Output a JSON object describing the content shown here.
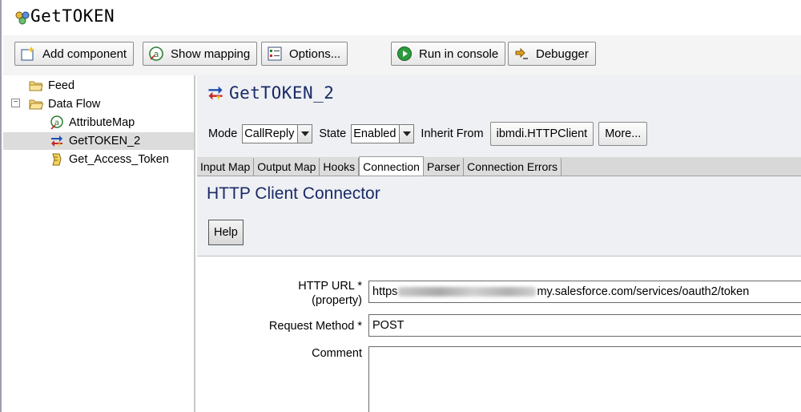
{
  "window": {
    "title": "GetTOKEN"
  },
  "toolbar": {
    "add_component": "Add component",
    "show_mapping": "Show mapping",
    "options": "Options...",
    "run_in_console": "Run in console",
    "debugger": "Debugger"
  },
  "tree": {
    "items": [
      {
        "label": "Feed",
        "icon": "folder-icon"
      },
      {
        "label": "Data Flow",
        "icon": "folder-open-icon"
      },
      {
        "label": "AttributeMap",
        "icon": "attribute-map-icon"
      },
      {
        "label": "GetTOKEN_2",
        "icon": "connector-icon",
        "selected": true
      },
      {
        "label": "Get_Access_Token",
        "icon": "script-icon"
      }
    ]
  },
  "component": {
    "title": "GetTOKEN_2",
    "mode_label": "Mode",
    "mode_value": "CallReply",
    "state_label": "State",
    "state_value": "Enabled",
    "inherit_label": "Inherit From",
    "inherit_value": "ibmdi.HTTPClient",
    "more_label": "More..."
  },
  "tabs": [
    "Input Map",
    "Output Map",
    "Hooks",
    "Connection",
    "Parser",
    "Connection Errors"
  ],
  "active_tab": "Connection",
  "connection": {
    "title": "HTTP Client Connector",
    "help_label": "Help",
    "fields": {
      "http_url_label_line1": "HTTP URL *",
      "http_url_label_line2": "(property)",
      "http_url_prefix": "https",
      "http_url_suffix": "my.salesforce.com/services/oauth2/token",
      "request_method_label": "Request Method *",
      "request_method_value": "POST",
      "comment_label": "Comment",
      "comment_value": ""
    }
  },
  "colors": {
    "title_blue": "#1a2a66",
    "header_bg": "#eef0f4",
    "run_green": "#2e9a3e"
  }
}
